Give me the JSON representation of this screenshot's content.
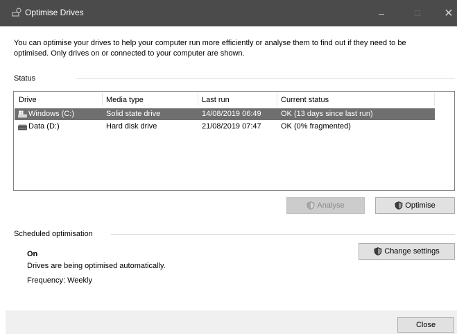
{
  "window": {
    "title": "Optimise Drives",
    "controls": {
      "minimize": "–",
      "maximize": "☐",
      "close": "✕"
    }
  },
  "intro_text": "You can optimise your drives to help your computer run more efficiently or analyse them to find out if they need to be optimised. Only drives on or connected to your computer are shown.",
  "status": {
    "label": "Status",
    "columns": [
      "Drive",
      "Media type",
      "Last run",
      "Current status"
    ],
    "drives": [
      {
        "drive": "Windows (C:)",
        "media_type": "Solid state drive",
        "last_run": "14/08/2019 06:49",
        "current_status": "OK (13 days since last run)",
        "icon": "windows-drive-icon",
        "selected": true
      },
      {
        "drive": "Data (D:)",
        "media_type": "Hard disk drive",
        "last_run": "21/08/2019 07:47",
        "current_status": "OK (0% fragmented)",
        "icon": "hard-drive-icon",
        "selected": false
      }
    ]
  },
  "actions": {
    "analyse_label": "Analyse",
    "optimise_label": "Optimise"
  },
  "scheduled": {
    "label": "Scheduled optimisation",
    "state": "On",
    "description": "Drives are being optimised automatically.",
    "frequency": "Frequency: Weekly",
    "change_settings_label": "Change settings"
  },
  "footer": {
    "close_label": "Close"
  },
  "colors": {
    "titlebar": "#4b4b4b",
    "selected_row": "#6f6f6f",
    "button_face": "#e1e1e1",
    "button_disabled": "#cccccc"
  }
}
